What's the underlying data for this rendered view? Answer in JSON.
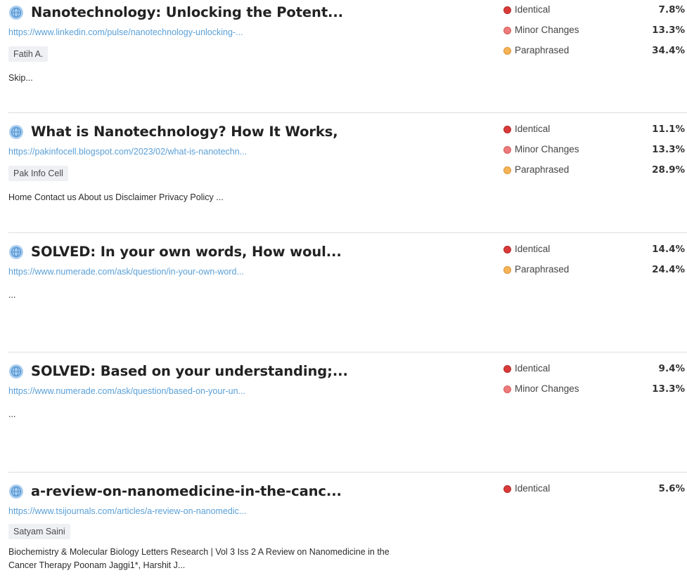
{
  "colors": {
    "identical": "#d93a3a",
    "minor": "#ee7b7b",
    "paraphrased": "#f6b458",
    "link": "#5aa0d8"
  },
  "results": [
    {
      "title": "Nanotechnology: Unlocking the Potent...",
      "url": "https://www.linkedin.com/pulse/nanotechnology-unlocking-...",
      "author": "Fatih A.",
      "snippet": "Skip...",
      "matches": [
        {
          "label": "Identical",
          "percent": "7.8%",
          "kind": "identical"
        },
        {
          "label": "Minor Changes",
          "percent": "13.3%",
          "kind": "minor"
        },
        {
          "label": "Paraphrased",
          "percent": "34.4%",
          "kind": "paraphrased"
        }
      ]
    },
    {
      "title": "What is Nanotechnology? How It Works,",
      "url": "https://pakinfocell.blogspot.com/2023/02/what-is-nanotechn...",
      "author": "Pak Info Cell",
      "snippet": "Home Contact us About us Disclaimer Privacy Policy ...",
      "matches": [
        {
          "label": "Identical",
          "percent": "11.1%",
          "kind": "identical"
        },
        {
          "label": "Minor Changes",
          "percent": "13.3%",
          "kind": "minor"
        },
        {
          "label": "Paraphrased",
          "percent": "28.9%",
          "kind": "paraphrased"
        }
      ]
    },
    {
      "title": "SOLVED: In your own words, How woul...",
      "url": "https://www.numerade.com/ask/question/in-your-own-word...",
      "author": "",
      "snippet": "...",
      "matches": [
        {
          "label": "Identical",
          "percent": "14.4%",
          "kind": "identical"
        },
        {
          "label": "Paraphrased",
          "percent": "24.4%",
          "kind": "paraphrased"
        }
      ]
    },
    {
      "title": "SOLVED: Based on your understanding;...",
      "url": "https://www.numerade.com/ask/question/based-on-your-un...",
      "author": "",
      "snippet": "...",
      "matches": [
        {
          "label": "Identical",
          "percent": "9.4%",
          "kind": "identical"
        },
        {
          "label": "Minor Changes",
          "percent": "13.3%",
          "kind": "minor"
        }
      ]
    },
    {
      "title": "a-review-on-nanomedicine-in-the-canc...",
      "url": "https://www.tsijournals.com/articles/a-review-on-nanomedic...",
      "author": "Satyam Saini",
      "snippet": "Biochemistry & Molecular Biology Letters Research | Vol 3 Iss 2 A Review on Nanomedicine in the Cancer Therapy Poonam Jaggi1*, Harshit J...",
      "matches": [
        {
          "label": "Identical",
          "percent": "5.6%",
          "kind": "identical"
        }
      ]
    }
  ]
}
